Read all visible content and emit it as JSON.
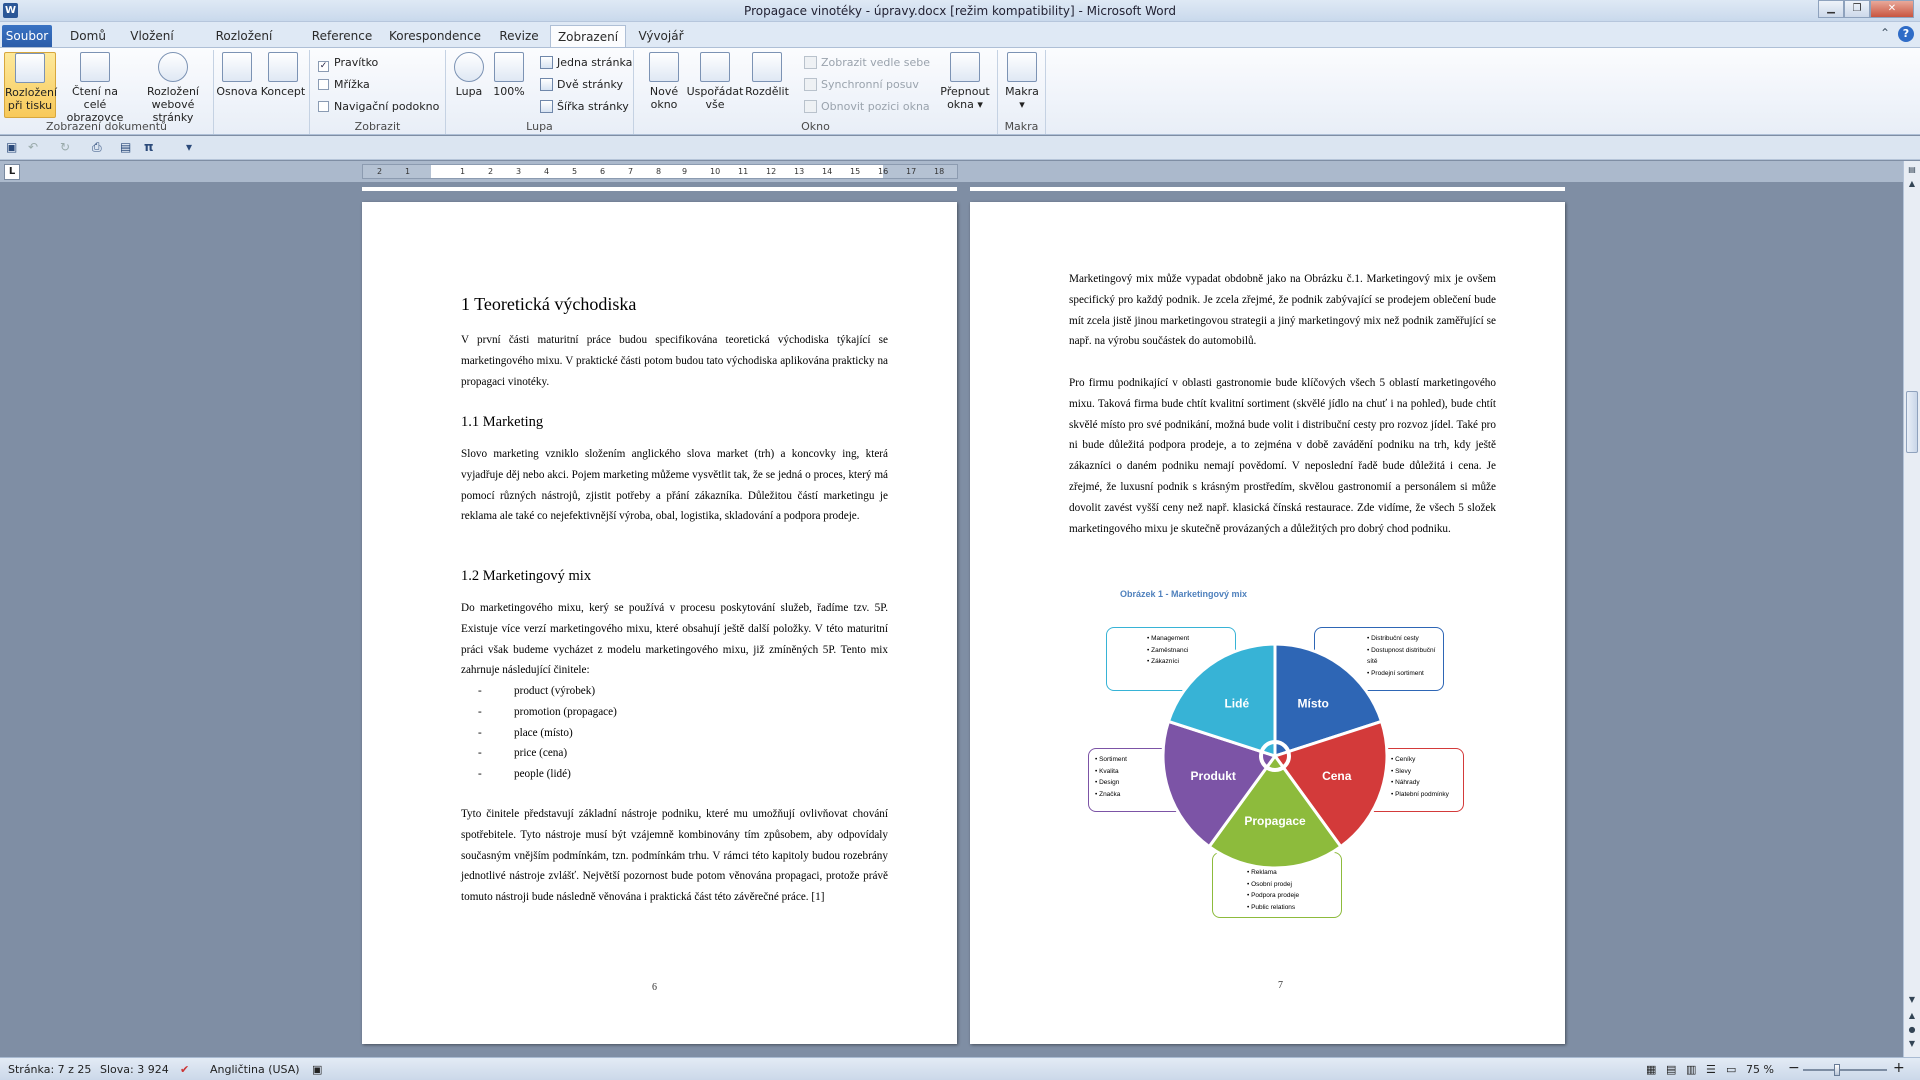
{
  "window": {
    "title": "Propagace vinotéky - úpravy.docx [režim kompatibility]  -  Microsoft Word",
    "app_icon": "W"
  },
  "tabs": [
    {
      "label": "Soubor"
    },
    {
      "label": "Domů"
    },
    {
      "label": "Vložení"
    },
    {
      "label": "Rozložení stránky"
    },
    {
      "label": "Reference"
    },
    {
      "label": "Korespondence"
    },
    {
      "label": "Revize"
    },
    {
      "label": "Zobrazení"
    },
    {
      "label": "Vývojář"
    }
  ],
  "ribbon": {
    "zobrazeni_dokumentu": {
      "label": "Zobrazení dokumentů",
      "print_layout": "Rozložení\npři tisku",
      "full_screen": "Čtení na celé\nobrazovce",
      "web_layout": "Rozložení\nwebové stránky",
      "outline": "Osnova",
      "draft": "Koncept"
    },
    "zobrazit": {
      "label": "Zobrazit",
      "ruler": "Pravítko",
      "gridlines": "Mřížka",
      "nav_pane": "Navigační podokno",
      "ruler_checked": "✓"
    },
    "lupa": {
      "label": "Lupa",
      "zoom": "Lupa",
      "zoom100": "100%",
      "one_page": "Jedna stránka",
      "two_pages": "Dvě stránky",
      "page_width": "Šířka stránky"
    },
    "okno": {
      "label": "Okno",
      "new_window": "Nové\nokno",
      "arrange_all": "Uspořádat\nvše",
      "split": "Rozdělit",
      "side_by_side": "Zobrazit vedle sebe",
      "sync_scroll": "Synchronní posuv",
      "reset_pos": "Obnovit pozici okna",
      "switch": "Přepnout\nokna ▾"
    },
    "makra": {
      "label": "Makra",
      "macros": "Makra\n▾"
    }
  },
  "qat": {
    "pi": "π"
  },
  "ruler": {
    "ticks": [
      "2",
      "1",
      "1",
      "2",
      "3",
      "4",
      "5",
      "6",
      "7",
      "8",
      "9",
      "10",
      "11",
      "12",
      "13",
      "14",
      "15",
      "16",
      "17",
      "18"
    ]
  },
  "page6": {
    "h1": "1   Teoretická východiska",
    "p1": "V první části maturitní práce budou specifikována teoretická východiska týkající se marketingového mixu. V praktické části potom budou tato východiska aplikována prakticky na propagaci vinotéky.",
    "h2a": "1.1   Marketing",
    "p2": "Slovo marketing vzniklo složením anglického slova market (trh) a koncovky ing, která vyjadřuje děj nebo akci. Pojem marketing můžeme vysvětlit tak, že se jedná o proces, který má pomocí různých nástrojů, zjistit potřeby a přání zákazníka. Důležitou částí marketingu je reklama ale také co nejefektivnější výroba, obal, logistika, skladování a podpora prodeje.",
    "h2b": "1.2   Marketingový mix",
    "p3": "Do marketingového mixu, kerý se používá v procesu poskytování služeb, řadíme tzv. 5P. Existuje více verzí marketingového mixu, které obsahují ještě další položky. V této maturitní práci však budeme vycházet z modelu marketingového mixu, již zmíněných 5P. Tento mix zahrnuje následující činitele:",
    "list": [
      "product (výrobek)",
      "promotion (propagace)",
      "place (místo)",
      "price (cena)",
      "people (lidé)"
    ],
    "p4": "Tyto činitele představují základní nástroje podniku, které mu umožňují ovlivňovat chování spotřebitele. Tyto nástroje musí být vzájemně kombinovány tím způsobem, aby odpovídaly současným vnějším podmínkám, tzn. podmínkám trhu. V rámci této kapitoly budou rozebrány jednotlivé nástroje zvlášť. Největší pozornost bude potom věnována propagaci, protože právě tomuto nástroji bude následně věnována i praktická část této závěrečné práce. [1]",
    "num": "6"
  },
  "page7": {
    "p1": "Marketingový mix může vypadat obdobně jako na Obrázku č.1. Marketingový mix je ovšem specifický pro každý podnik. Je zcela zřejmé, že podnik zabývající se prodejem oblečení bude mít zcela jistě jinou marketingovou strategii a jiný marketingový mix než podnik zaměřující se např. na výrobu součástek do automobilů.",
    "p2": "Pro firmu podnikající v oblasti gastronomie bude klíčových všech 5 oblastí marketingového mixu. Taková firma bude chtít kvalitní sortiment (skvělé jídlo na chuť i na pohled), bude chtít skvělé místo pro své podnikání, možná bude volit i distribuční cesty pro rozvoz jídel. Také pro ni bude důležitá podpora prodeje, a to zejména v době zavádění podniku na trh, kdy ještě zákazníci o daném podniku nemají povědomí. V neposlední řadě bude důležitá i cena. Je zřejmé, že luxusní podnik s krásným prostředím, skvělou gastronomií a personálem si může dovolit zavést vyšší ceny než např. klasická čínská restaurace. Zde vidíme, že všech 5 složek marketingového mixu je skutečně provázaných a důležitých pro dobrý chod podniku.",
    "caption": "Obrázek 1 - Marketingový mix",
    "num": "7"
  },
  "diagram": {
    "segments": [
      {
        "label": "Místo",
        "color": "#2e66b5",
        "items": [
          "Distribuční cesty",
          "Dostupnost distribuční sítě",
          "Prodejní sortiment"
        ]
      },
      {
        "label": "Cena",
        "color": "#d33a3a",
        "items": [
          "Ceníky",
          "Slevy",
          "Náhrady",
          "Platební podmínky"
        ]
      },
      {
        "label": "Propagace",
        "color": "#8dbb3c",
        "items": [
          "Reklama",
          "Osobní prodej",
          "Podpora prodeje",
          "Public relations"
        ]
      },
      {
        "label": "Produkt",
        "color": "#7c54a6",
        "items": [
          "Sortiment",
          "Kvalita",
          "Design",
          "Značka"
        ]
      },
      {
        "label": "Lidé",
        "color": "#37b3d6",
        "items": [
          "Management",
          "Zaměstnanci",
          "Zákazníci"
        ]
      }
    ]
  },
  "status": {
    "page": "Stránka: 7 z 25",
    "words": "Slova: 3 924",
    "language": "Angličtina (USA)",
    "zoom": "75 %",
    "minus": "−",
    "plus": "+"
  }
}
